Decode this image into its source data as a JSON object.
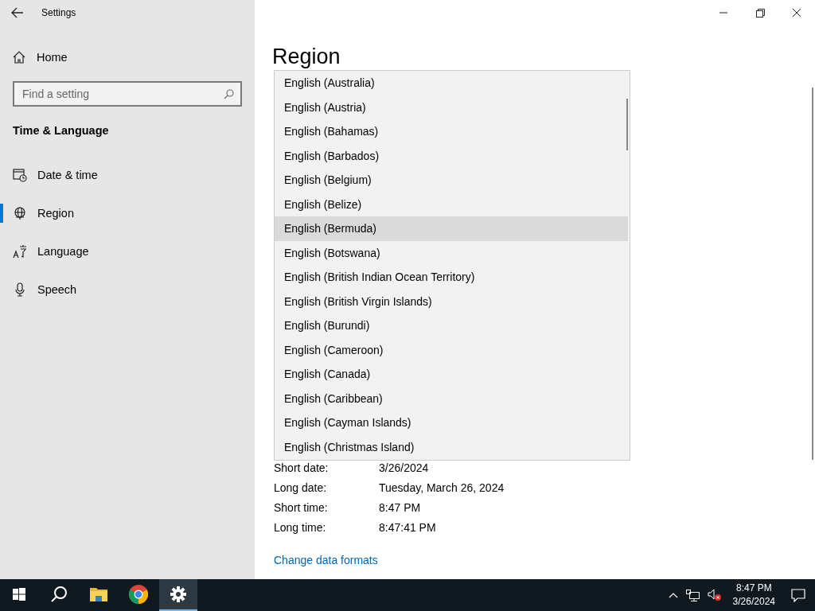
{
  "window": {
    "title": "Settings"
  },
  "sidebar": {
    "home": "Home",
    "search": {
      "placeholder": "Find a setting"
    },
    "section": "Time & Language",
    "items": [
      {
        "label": "Date & time",
        "kind": "calendar",
        "selected": false
      },
      {
        "label": "Region",
        "kind": "globe",
        "selected": true
      },
      {
        "label": "Language",
        "kind": "language",
        "selected": false
      },
      {
        "label": "Speech",
        "kind": "microphone",
        "selected": false
      }
    ]
  },
  "main": {
    "heading": "Region",
    "dropdown": {
      "options": [
        {
          "label": "English (Australia)",
          "highlighted": false
        },
        {
          "label": "English (Austria)",
          "highlighted": false
        },
        {
          "label": "English (Bahamas)",
          "highlighted": false
        },
        {
          "label": "English (Barbados)",
          "highlighted": false
        },
        {
          "label": "English (Belgium)",
          "highlighted": false
        },
        {
          "label": "English (Belize)",
          "highlighted": false
        },
        {
          "label": "English (Bermuda)",
          "highlighted": true
        },
        {
          "label": "English (Botswana)",
          "highlighted": false
        },
        {
          "label": "English (British Indian Ocean Territory)",
          "highlighted": false
        },
        {
          "label": "English (British Virgin Islands)",
          "highlighted": false
        },
        {
          "label": "English (Burundi)",
          "highlighted": false
        },
        {
          "label": "English (Cameroon)",
          "highlighted": false
        },
        {
          "label": "English (Canada)",
          "highlighted": false
        },
        {
          "label": "English (Caribbean)",
          "highlighted": false
        },
        {
          "label": "English (Cayman Islands)",
          "highlighted": false
        },
        {
          "label": "English (Christmas Island)",
          "highlighted": false
        }
      ]
    },
    "formats": [
      {
        "label": "Short date:",
        "value": "3/26/2024"
      },
      {
        "label": "Long date:",
        "value": "Tuesday, March 26, 2024"
      },
      {
        "label": "Short time:",
        "value": "8:47 PM"
      },
      {
        "label": "Long time:",
        "value": "8:47:41 PM"
      }
    ],
    "link": "Change data formats"
  },
  "taskbar": {
    "apps": [
      {
        "kind": "start",
        "selected": false
      },
      {
        "kind": "search",
        "selected": false
      },
      {
        "kind": "folder",
        "selected": false
      },
      {
        "kind": "browser",
        "selected": false
      },
      {
        "kind": "settings",
        "selected": true
      }
    ],
    "time": "8:47 PM",
    "date": "3/26/2024"
  }
}
